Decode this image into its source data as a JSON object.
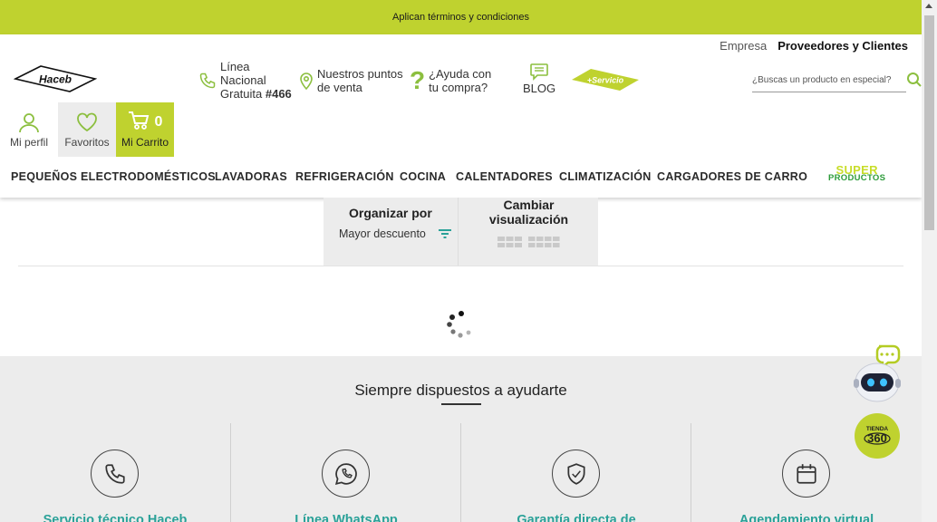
{
  "topbar": {
    "text": "Aplican términos y condiciones"
  },
  "header": {
    "toplinks": {
      "empresa": "Empresa",
      "proveedores": "Proveedores y Clientes"
    },
    "logo_text": "Haceb",
    "linea": {
      "line1": "Línea",
      "line2": "Nacional",
      "line3_prefix": "Gratuita ",
      "line3_number": "#466"
    },
    "puntos": {
      "line1": "Nuestros puntos",
      "line2": "de venta"
    },
    "ayuda": {
      "line1": "¿Ayuda con",
      "line2": "tu compra?"
    },
    "blog": "BLOG",
    "servicio_text": "+Servicio",
    "search": {
      "placeholder": "¿Buscas un producto en especial?"
    },
    "user": {
      "perfil": "Mi perfil",
      "favoritos": "Favoritos",
      "carrito": "Mi Carrito",
      "cart_count": "0"
    },
    "nav": [
      "PEQUEÑOS ELECTRODOMÉSTICOS",
      "LAVADORAS",
      "REFRIGERACIÓN",
      "COCINA",
      "CALENTADORES",
      "CLIMATIZACIÓN",
      "CARGADORES DE CARRO"
    ],
    "super": {
      "line1": "SUPER",
      "line2": "PRODUCTOS"
    }
  },
  "sort": {
    "organizar_title": "Organizar por",
    "organizar_value": "Mayor descuento",
    "cambiar_line1": "Cambiar",
    "cambiar_line2": "visualización"
  },
  "help": {
    "title": "Siempre dispuestos a ayudarte",
    "cards": [
      {
        "label": "Servicio técnico Haceb",
        "icon": "phone-icon"
      },
      {
        "label": "Línea WhatsApp",
        "icon": "whatsapp-icon"
      },
      {
        "label": "Garantía directa de",
        "icon": "shield-check-icon"
      },
      {
        "label": "Agendamiento virtual",
        "icon": "calendar-icon"
      }
    ]
  },
  "tienda_text": "TIENDA 360",
  "colors": {
    "brand_green": "#bfd22f",
    "teal": "#2aa198",
    "dark_green": "#2c9b3a"
  }
}
